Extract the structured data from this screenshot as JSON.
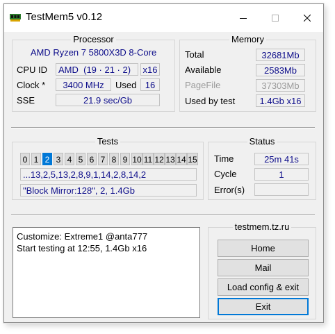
{
  "window": {
    "title": "TestMem5 v0.12",
    "icons": {
      "app": "memory-chip-icon",
      "minimize": "minimize-icon",
      "maximize": "maximize-icon",
      "close": "close-icon"
    }
  },
  "processor": {
    "group_title": "Processor",
    "name": "AMD Ryzen 7 5800X3D 8-Core",
    "cpu_id_label": "CPU ID",
    "cpu_vendor": "AMD",
    "cpu_id": "(19 · 21 · 2)",
    "threads": "x16",
    "clock_label": "Clock *",
    "clock": "3400 MHz",
    "used_label": "Used",
    "used": "16",
    "sse_label": "SSE",
    "sse": "21.9 sec/Gb"
  },
  "memory": {
    "group_title": "Memory",
    "total_label": "Total",
    "total": "32681Mb",
    "available_label": "Available",
    "available": "2583Mb",
    "pagefile_label": "PageFile",
    "pagefile": "37303Mb",
    "used_by_test_label": "Used by test",
    "used_by_test": "1.4Gb x16"
  },
  "tests": {
    "group_title": "Tests",
    "numbers": [
      "0",
      "1",
      "2",
      "3",
      "4",
      "5",
      "6",
      "7",
      "8",
      "9",
      "10",
      "11",
      "12",
      "13",
      "14",
      "15"
    ],
    "active_index": 2,
    "sequence": "...13,2,5,13,2,8,9,1,14,2,8,14,2",
    "current": "\"Block Mirror:128\", 2, 1.4Gb"
  },
  "status": {
    "group_title": "Status",
    "time_label": "Time",
    "time": "25m 41s",
    "cycle_label": "Cycle",
    "cycle": "1",
    "errors_label": "Error(s)",
    "errors": ""
  },
  "log": {
    "lines": [
      "Customize: Extreme1 @anta777",
      "Start testing at 12:55, 1.4Gb x16"
    ]
  },
  "links": {
    "group_title": "testmem.tz.ru",
    "home": "Home",
    "mail": "Mail",
    "load_config": "Load config & exit",
    "exit": "Exit"
  },
  "colors": {
    "accent": "#0078d7",
    "value_text": "#0d0d8a",
    "disabled_text": "#9b9b9b",
    "window_bg": "#f0f0f0"
  }
}
